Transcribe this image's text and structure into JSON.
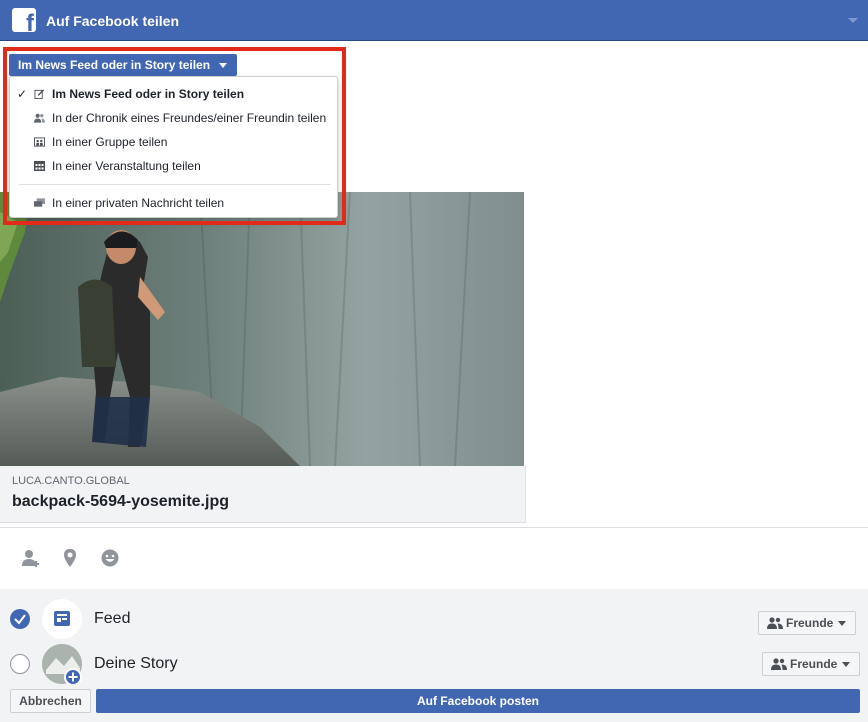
{
  "header": {
    "title": "Auf Facebook teilen",
    "logo_icon": "facebook-logo-icon",
    "logo_glyph": "f",
    "accent": "#4267b2"
  },
  "share_target": {
    "selected_label": "Im News Feed oder in Story teilen",
    "items": [
      {
        "label": "Im News Feed oder in Story teilen",
        "icon": "edit-icon",
        "selected": true
      },
      {
        "label": "In der Chronik eines Freundes/einer Freundin teilen",
        "icon": "friends-icon",
        "selected": false
      },
      {
        "label": "In einer Gruppe teilen",
        "icon": "group-icon",
        "selected": false
      },
      {
        "label": "In einer Veranstaltung teilen",
        "icon": "calendar-icon",
        "selected": false
      },
      {
        "label": "In einer privaten Nachricht teilen",
        "icon": "message-icon",
        "selected": false
      }
    ],
    "check_glyph": "✓",
    "highlight_color": "#e02b1b"
  },
  "link_preview": {
    "domain": "LUCA.CANTO.GLOBAL",
    "filename": "backpack-5694-yosemite.jpg"
  },
  "toolbar": {
    "icons": [
      "tag-friends-icon",
      "location-pin-icon",
      "feeling-emoji-icon"
    ]
  },
  "destinations": [
    {
      "label": "Feed",
      "checked": true,
      "audience": "Freunde",
      "avatar_icon": "feed-icon"
    },
    {
      "label": "Deine Story",
      "checked": false,
      "audience": "Freunde",
      "avatar_icon": "story-add-icon"
    }
  ],
  "actions": {
    "cancel": "Abbrechen",
    "post": "Auf Facebook posten"
  }
}
